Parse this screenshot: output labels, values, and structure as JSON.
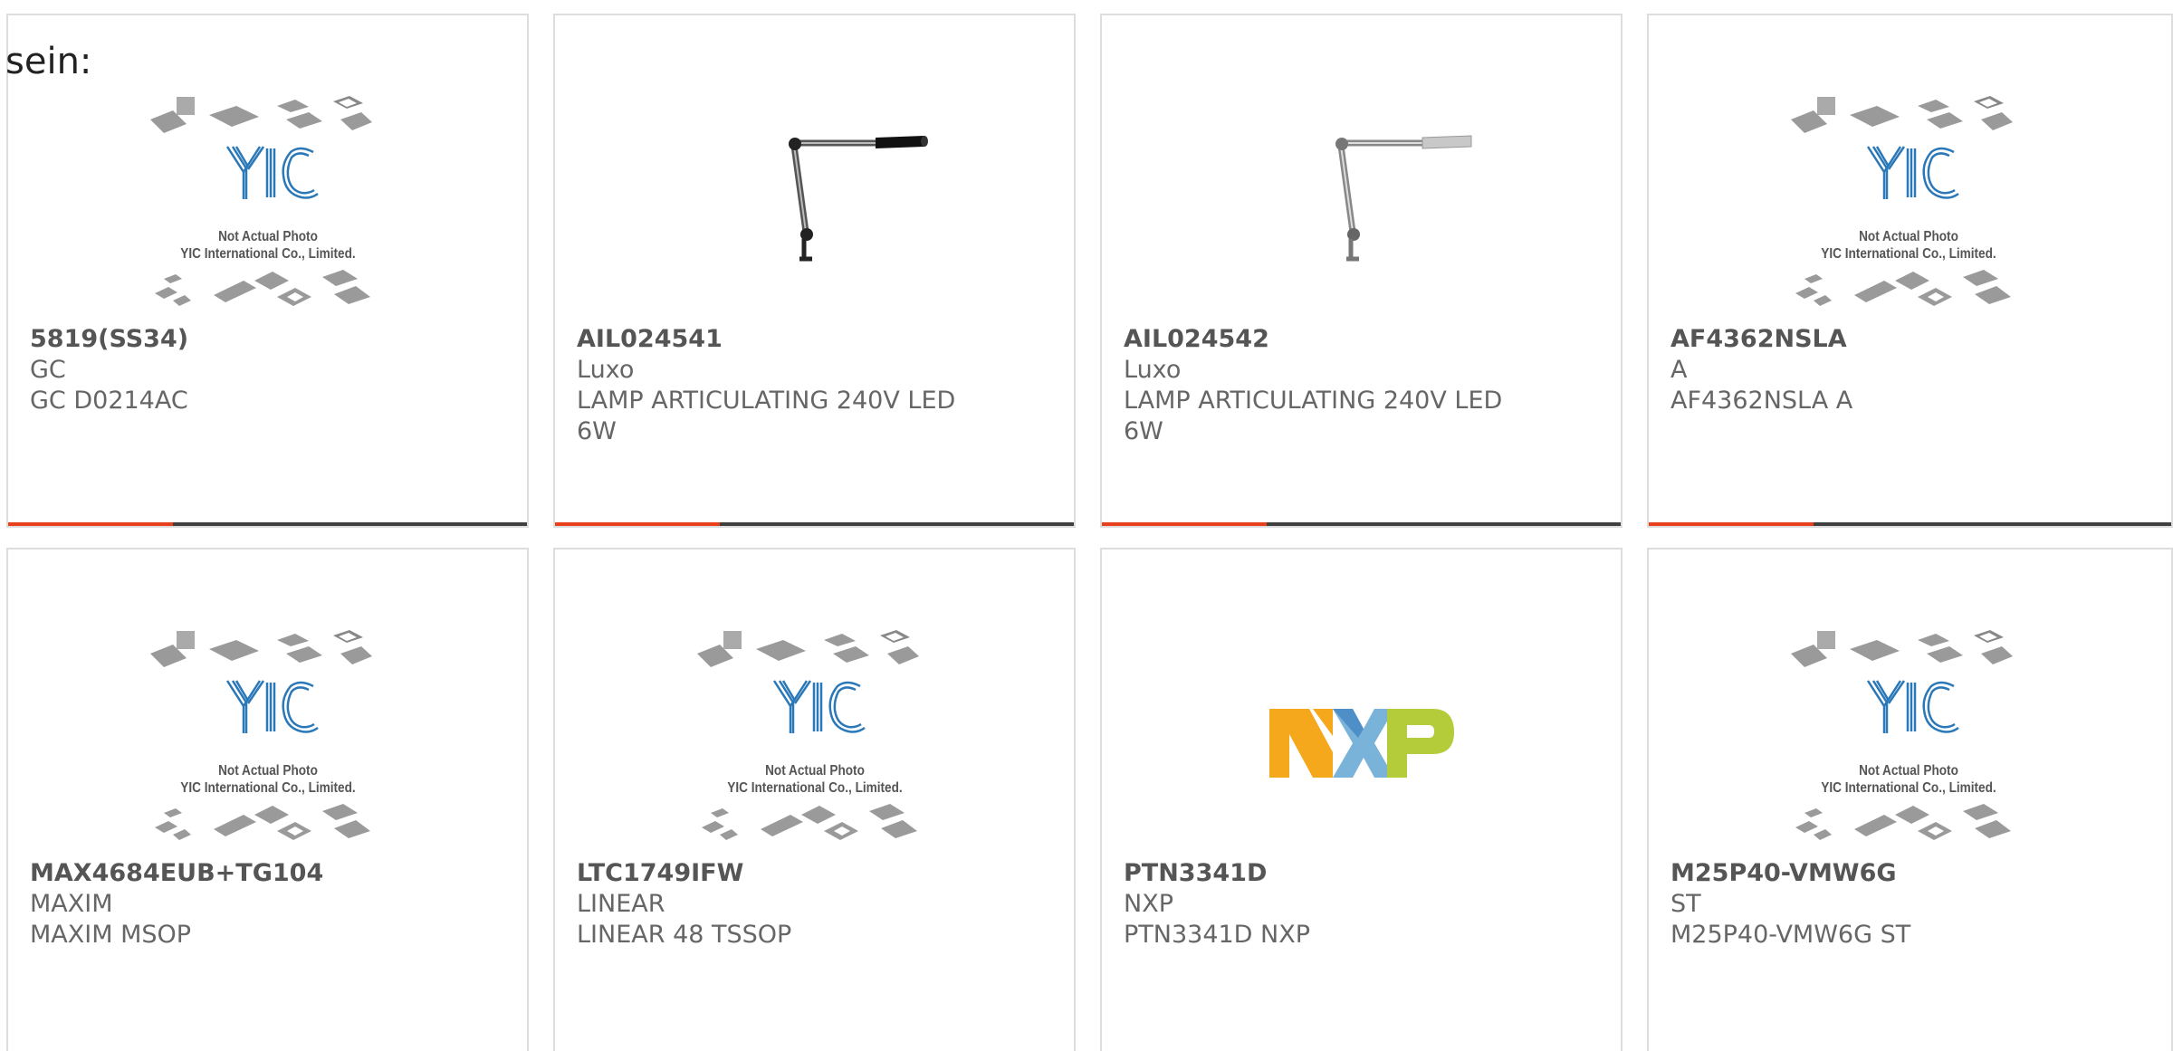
{
  "page": {
    "intro_text": "sein:"
  },
  "colors": {
    "accent": "#e8401c",
    "bar_dark": "#404040",
    "yic_blue": "#2a78b8",
    "nxp_yellow": "#f5a81c",
    "nxp_blue": "#7ab3d9",
    "nxp_green": "#b5cc3a"
  },
  "placeholder": {
    "line1": "Not Actual Photo",
    "line2": "YIC International Co., Limited."
  },
  "products": [
    {
      "part_no": "5819(SS34)",
      "manufacturer": "GC",
      "description": "GC D0214AC",
      "image": "placeholder-icon"
    },
    {
      "part_no": "AIL024541",
      "manufacturer": "Luxo",
      "description": "LAMP ARTICULATING 240V LED 6W",
      "image": "desk-lamp-black-icon"
    },
    {
      "part_no": "AIL024542",
      "manufacturer": "Luxo",
      "description": "LAMP ARTICULATING 240V LED 6W",
      "image": "desk-lamp-silver-icon"
    },
    {
      "part_no": "AF4362NSLA",
      "manufacturer": "A",
      "description": "AF4362NSLA A",
      "image": "placeholder-icon"
    },
    {
      "part_no": "MAX4684EUB+TG104",
      "manufacturer": "MAXIM",
      "description": "MAXIM MSOP",
      "image": "placeholder-icon"
    },
    {
      "part_no": "LTC1749IFW",
      "manufacturer": "LINEAR",
      "description": "LINEAR 48 TSSOP",
      "image": "placeholder-icon"
    },
    {
      "part_no": "PTN3341D",
      "manufacturer": "NXP",
      "description": "PTN3341D NXP",
      "image": "nxp-logo"
    },
    {
      "part_no": "M25P40-VMW6G",
      "manufacturer": "ST",
      "description": "M25P40-VMW6G ST",
      "image": "placeholder-icon"
    }
  ]
}
